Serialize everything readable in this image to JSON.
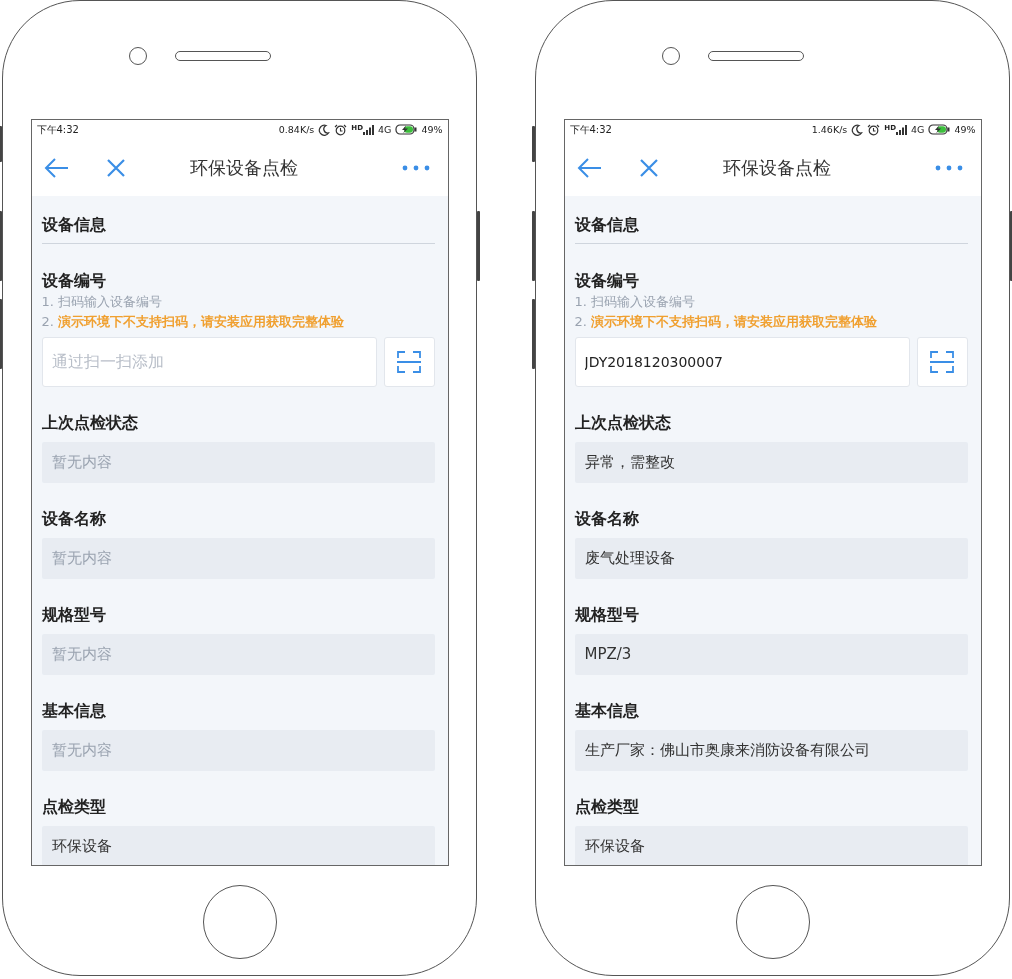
{
  "phones": [
    {
      "status_bar": {
        "time": "下午4:32",
        "speed": "0.84K/s",
        "signal_label": "HD",
        "network": "4G",
        "battery": "49%"
      },
      "header": {
        "title": "环保设备点检"
      },
      "section_title": "设备信息",
      "device_no": {
        "label": "设备编号",
        "hints": [
          {
            "number": "1.",
            "text": "扫码输入设备编号",
            "kind": "note"
          },
          {
            "number": "2.",
            "text": "演示环境下不支持扫码，请安装应用获取完整体验",
            "kind": "warning"
          }
        ],
        "input": {
          "placeholder": "通过扫一扫添加"
        }
      },
      "fields": [
        {
          "label": "上次点检状态",
          "placeholder": "暂无内容"
        },
        {
          "label": "设备名称",
          "placeholder": "暂无内容"
        },
        {
          "label": "规格型号",
          "placeholder": "暂无内容"
        },
        {
          "label": "基本信息",
          "placeholder": "暂无内容"
        },
        {
          "label": "点检类型",
          "value": "环保设备"
        }
      ]
    },
    {
      "status_bar": {
        "time": "下午4:32",
        "speed": "1.46K/s",
        "signal_label": "HD",
        "network": "4G",
        "battery": "49%"
      },
      "header": {
        "title": "环保设备点检"
      },
      "section_title": "设备信息",
      "device_no": {
        "label": "设备编号",
        "hints": [
          {
            "number": "1.",
            "text": "扫码输入设备编号",
            "kind": "note"
          },
          {
            "number": "2.",
            "text": "演示环境下不支持扫码，请安装应用获取完整体验",
            "kind": "warning"
          }
        ],
        "input": {
          "value": "JDY2018120300007"
        }
      },
      "fields": [
        {
          "label": "上次点检状态",
          "value": "异常，需整改"
        },
        {
          "label": "设备名称",
          "value": "废气处理设备"
        },
        {
          "label": "规格型号",
          "value": "MPZ/3"
        },
        {
          "label": "基本信息",
          "value": "生产厂家：佛山市奥康来消防设备有限公司"
        },
        {
          "label": "点检类型",
          "value": "环保设备"
        }
      ]
    }
  ]
}
